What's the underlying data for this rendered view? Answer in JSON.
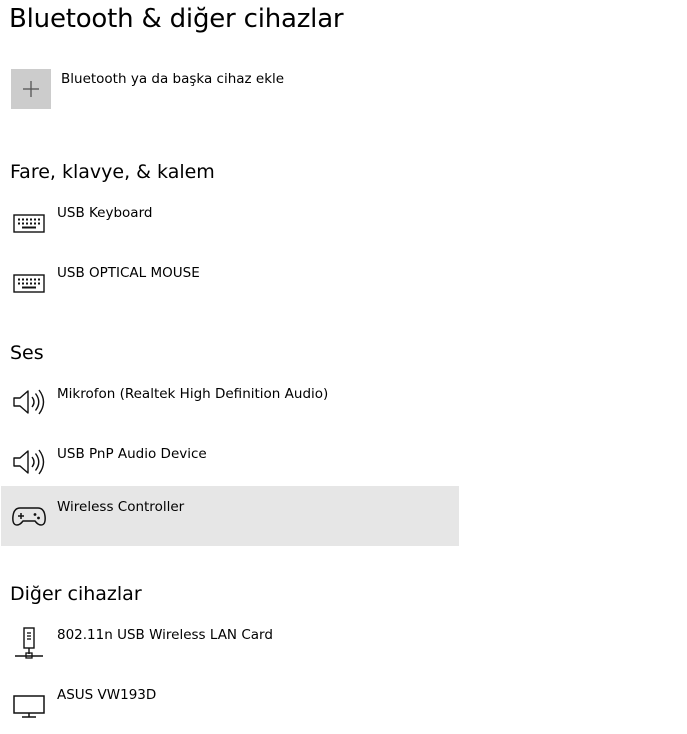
{
  "title": "Bluetooth & diğer cihazlar",
  "add_device": {
    "label": "Bluetooth ya da başka cihaz ekle",
    "icon": "plus-icon"
  },
  "sections": [
    {
      "header": "Fare, klavye, & kalem",
      "devices": [
        {
          "name": "USB Keyboard",
          "icon": "keyboard-icon"
        },
        {
          "name": "USB OPTICAL MOUSE",
          "icon": "keyboard-icon"
        }
      ]
    },
    {
      "header": "Ses",
      "devices": [
        {
          "name": "Mikrofon (Realtek High Definition Audio)",
          "icon": "speaker-icon"
        },
        {
          "name": "USB PnP Audio Device",
          "icon": "speaker-icon"
        },
        {
          "name": "Wireless Controller",
          "icon": "gamepad-icon",
          "selected": true
        }
      ]
    },
    {
      "header": "Diğer cihazlar",
      "devices": [
        {
          "name": "802.11n USB Wireless LAN Card",
          "icon": "network-adapter-icon"
        },
        {
          "name": "ASUS VW193D",
          "icon": "monitor-icon"
        }
      ]
    }
  ],
  "colors": {
    "selected_background": "#e6e6e6",
    "add_tile_background": "#cccccc",
    "text": "#000000"
  }
}
